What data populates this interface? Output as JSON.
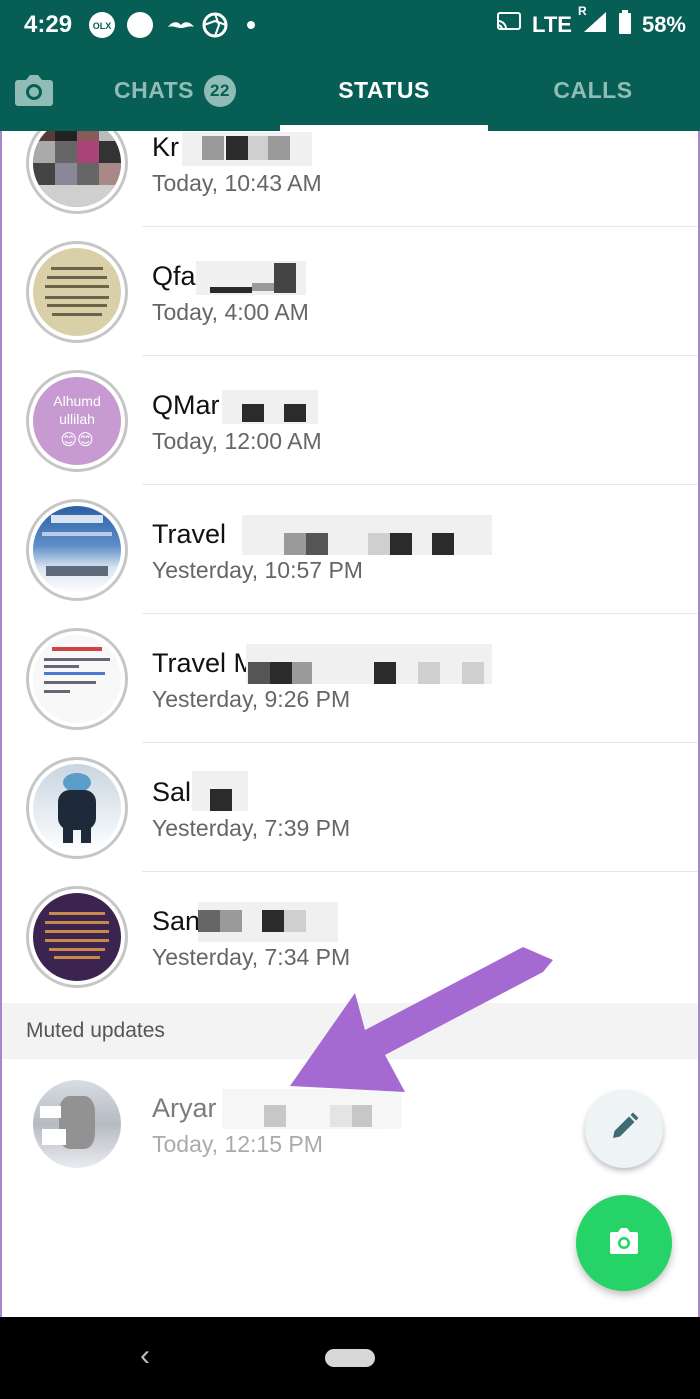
{
  "statusbar": {
    "time": "4:29",
    "network": "LTE",
    "roaming": "R",
    "battery": "58%",
    "notification_app_label": "OLX"
  },
  "tabs": {
    "chats_label": "CHATS",
    "chats_badge": "22",
    "status_label": "STATUS",
    "calls_label": "CALLS",
    "active": "status"
  },
  "updates": [
    {
      "name": "Kr",
      "time": "Today, 10:43 AM"
    },
    {
      "name": "Qfa",
      "time": "Today, 4:00 AM"
    },
    {
      "name": "QMar",
      "time": "Today, 12:00 AM",
      "avatar_text": "Alhumd ullilah",
      "avatar_emoji": "😊😊"
    },
    {
      "name": "Travel",
      "time": "Yesterday, 10:57 PM"
    },
    {
      "name": "Travel M",
      "time": "Yesterday, 9:26 PM"
    },
    {
      "name": "Sal",
      "time": "Yesterday, 7:39 PM"
    },
    {
      "name": "San",
      "time": "Yesterday, 7:34 PM"
    }
  ],
  "muted": {
    "header": "Muted updates",
    "items": [
      {
        "name": "Aryar",
        "time": "Today, 12:15 PM"
      }
    ]
  },
  "colors": {
    "header_bg": "#075e54",
    "tab_inactive": "#8fbdb6",
    "fab_green": "#26d367",
    "annotation_arrow": "#a46ad1"
  }
}
